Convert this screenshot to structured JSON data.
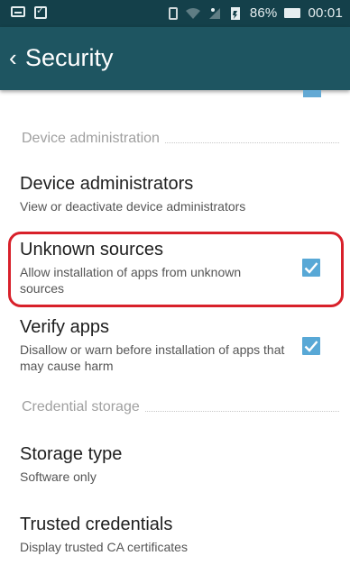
{
  "status_bar": {
    "battery_percent": "86%",
    "time": "00:01"
  },
  "app_bar": {
    "back_glyph": "‹",
    "title": "Security"
  },
  "categories": {
    "device_administration": "Device administration",
    "credential_storage": "Credential storage"
  },
  "items": {
    "device_administrators": {
      "title": "Device administrators",
      "summary": "View or deactivate device administrators"
    },
    "unknown_sources": {
      "title": "Unknown sources",
      "summary": "Allow installation of apps from unknown sources",
      "checked": true
    },
    "verify_apps": {
      "title": "Verify apps",
      "summary": "Disallow or warn before installation of apps that may cause harm",
      "checked": true
    },
    "storage_type": {
      "title": "Storage type",
      "summary": "Software only"
    },
    "trusted_credentials": {
      "title": "Trusted credentials",
      "summary": "Display trusted CA certificates"
    }
  },
  "colors": {
    "status_bar": "#14404a",
    "app_bar": "#1e5561",
    "checkbox": "#58a8d6",
    "highlight": "#d8202a"
  },
  "icons": {
    "status_left": [
      "message-icon",
      "clipboard-check-icon"
    ],
    "status_right": [
      "vibrate-icon",
      "wifi-icon",
      "signal-icon",
      "battery-saver-icon",
      "battery-icon"
    ],
    "back": "chevron-left-icon",
    "check": "check-icon"
  }
}
